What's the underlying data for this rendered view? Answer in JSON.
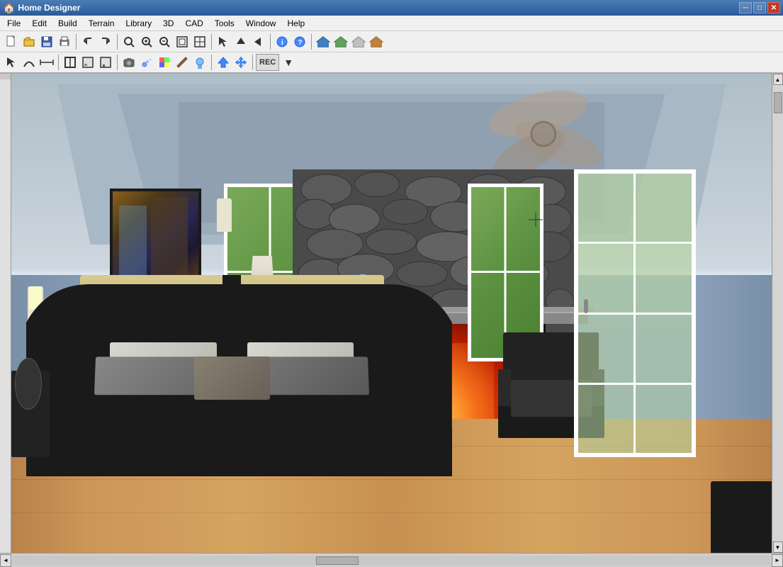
{
  "window": {
    "title": "Home Designer",
    "icon": "🏠"
  },
  "title_bar": {
    "controls": {
      "minimize": "─",
      "maximize": "□",
      "close": "✕"
    }
  },
  "menu": {
    "items": [
      "File",
      "Edit",
      "Build",
      "Terrain",
      "Library",
      "3D",
      "CAD",
      "Tools",
      "Window",
      "Help"
    ]
  },
  "toolbar1": {
    "buttons": [
      {
        "name": "new",
        "icon": "📄"
      },
      {
        "name": "open",
        "icon": "📂"
      },
      {
        "name": "save",
        "icon": "💾"
      },
      {
        "name": "print",
        "icon": "🖨"
      },
      {
        "name": "undo",
        "icon": "↩"
      },
      {
        "name": "redo",
        "icon": "↪"
      },
      {
        "name": "zoom-in-glass",
        "icon": "🔍"
      },
      {
        "name": "zoom-in",
        "icon": "⊕"
      },
      {
        "name": "zoom-out",
        "icon": "⊖"
      },
      {
        "name": "zoom-fit",
        "icon": "⊞"
      },
      {
        "name": "zoom-box",
        "icon": "⊡"
      },
      {
        "name": "fill",
        "icon": "⬛"
      },
      {
        "name": "triangle-up",
        "icon": "▲"
      },
      {
        "name": "arrow-right",
        "icon": "→"
      },
      {
        "name": "up",
        "icon": "↑"
      },
      {
        "name": "info",
        "icon": "ℹ"
      },
      {
        "name": "help",
        "icon": "?"
      },
      {
        "name": "sep"
      },
      {
        "name": "house",
        "icon": "🏠"
      },
      {
        "name": "house2",
        "icon": "🏡"
      },
      {
        "name": "house3",
        "icon": "⌂"
      },
      {
        "name": "building",
        "icon": "🏢"
      }
    ]
  },
  "toolbar2": {
    "buttons": [
      {
        "name": "arrow-select",
        "icon": "↖"
      },
      {
        "name": "curve-select",
        "icon": "⌒"
      },
      {
        "name": "measure",
        "icon": "⊢"
      },
      {
        "name": "floor-plan",
        "icon": "⊞"
      },
      {
        "name": "stair",
        "icon": "⊟"
      },
      {
        "name": "wall",
        "icon": "⊡"
      },
      {
        "name": "camera",
        "icon": "📷"
      },
      {
        "name": "spray",
        "icon": "💨"
      },
      {
        "name": "paint",
        "icon": "🎨"
      },
      {
        "name": "material",
        "icon": "🖌"
      },
      {
        "name": "texture",
        "icon": "◈"
      },
      {
        "name": "arrow-up-fill",
        "icon": "⬆"
      },
      {
        "name": "move",
        "icon": "✛"
      },
      {
        "name": "record",
        "icon": "REC"
      }
    ]
  },
  "scrollbar": {
    "up": "▲",
    "down": "▼",
    "left": "◄",
    "right": "►"
  },
  "scene": {
    "description": "3D bedroom interior with fireplace"
  }
}
